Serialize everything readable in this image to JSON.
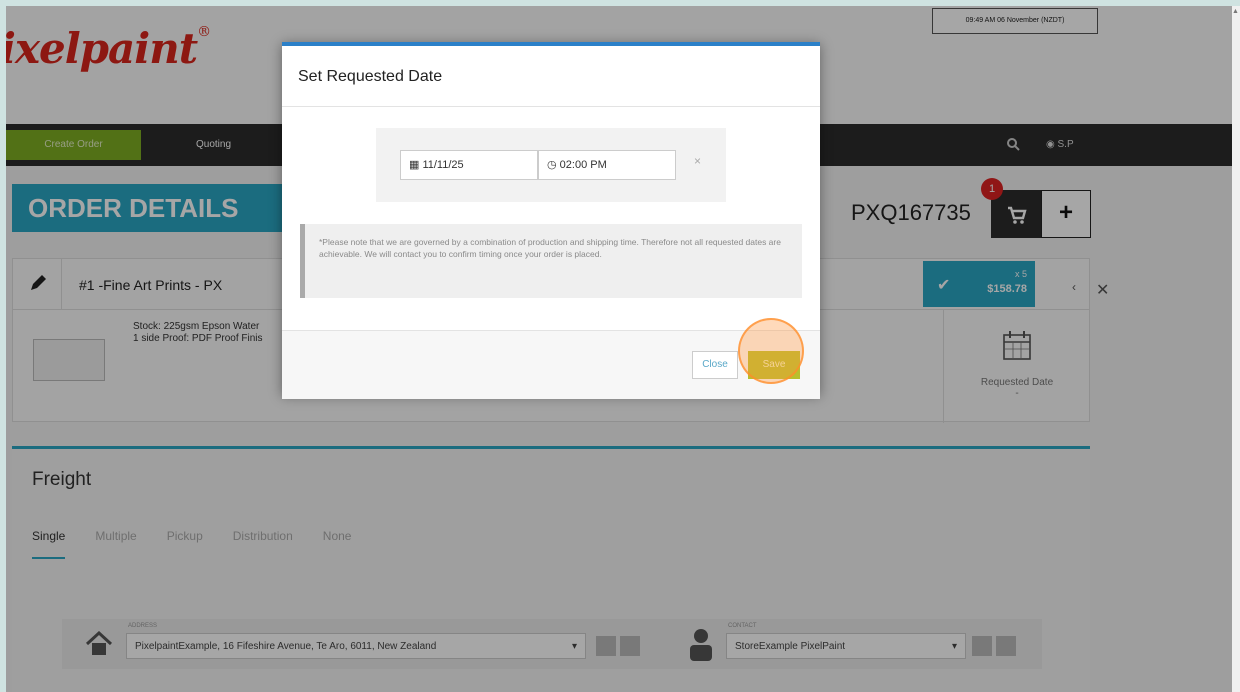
{
  "header": {
    "logo_text": "ixelpaint",
    "logo_mark": "®",
    "datetime": "09:49 AM 06 November (NZDT)"
  },
  "nav": {
    "create_order": "Create Order",
    "quoting": "Quoting",
    "user": "S.P"
  },
  "order": {
    "title": "ORDER DETAILS",
    "quote_number": "PXQ167735",
    "cart_count": "1",
    "plus_label": "+"
  },
  "item": {
    "title": "#1 -Fine Art Prints - PX",
    "stock_line1": "Stock: 225gsm Epson Water",
    "stock_line2": "1 side Proof: PDF Proof Finis",
    "qty": "x 5",
    "price": "$158.78",
    "requested_date_label": "Requested Date",
    "requested_date_value": "-"
  },
  "freight": {
    "title": "Freight",
    "tabs": [
      "Single",
      "Multiple",
      "Pickup",
      "Distribution",
      "None"
    ],
    "address_label": "ADDRESS",
    "address_value": "PixelpaintExample, 16 Fifeshire Avenue, Te Aro, 6011, New Zealand",
    "contact_label": "CONTACT",
    "contact_value": "StoreExample PixelPaint"
  },
  "modal": {
    "title": "Set Requested Date",
    "date_value": "11/11/25",
    "time_value": "02:00 PM",
    "clear_symbol": "×",
    "note": "*Please note that we are governed by a combination of production and shipping time. Therefore not all requested dates are achievable. We will contact you to confirm timing once your order is placed.",
    "close_label": "Close",
    "save_label": "Save"
  },
  "colors": {
    "accent_blue": "#2aa6c4",
    "nav_dark": "#2b2b2b",
    "create_green": "#7fae23",
    "save_olive": "#b8bf2c",
    "badge_red": "#d22222"
  }
}
